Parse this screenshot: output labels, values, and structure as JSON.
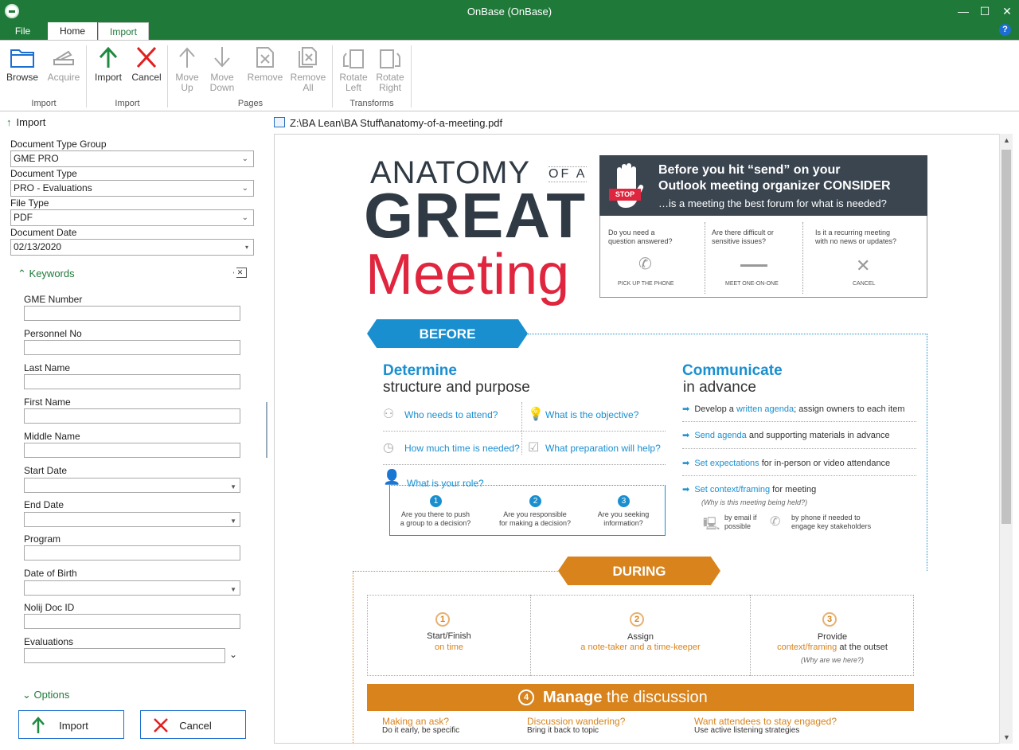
{
  "window": {
    "title": "OnBase (OnBase)",
    "minimize": "—",
    "maximize": "☐",
    "close": "✕",
    "help": "?"
  },
  "tabs": [
    {
      "label": "File"
    },
    {
      "label": "Home"
    },
    {
      "label": "Import"
    }
  ],
  "ribbon": {
    "browse": "Browse",
    "acquire": "Acquire",
    "import": "Import",
    "cancel": "Cancel",
    "move_up": [
      "Move",
      "Up"
    ],
    "move_down": [
      "Move",
      "Down"
    ],
    "remove": "Remove",
    "remove_all": [
      "Remove",
      "All"
    ],
    "rotate_left": [
      "Rotate",
      "Left"
    ],
    "rotate_right": [
      "Rotate",
      "Right"
    ],
    "groups": [
      "Import",
      "Import",
      "Pages",
      "Transforms"
    ]
  },
  "import_pane": {
    "header": "Import",
    "doc_type_group_label": "Document Type Group",
    "doc_type_group_value": "GME PRO",
    "doc_type_label": "Document Type",
    "doc_type_value": "PRO - Evaluations",
    "file_type_label": "File Type",
    "file_type_value": "PDF",
    "doc_date_label": "Document Date",
    "doc_date_value": "02/13/2020",
    "keywords_header": "Keywords",
    "keywords": [
      {
        "label": "GME Number"
      },
      {
        "label": "Personnel No"
      },
      {
        "label": "Last Name"
      },
      {
        "label": "First Name"
      },
      {
        "label": "Middle Name"
      },
      {
        "label": "Start Date"
      },
      {
        "label": "End Date"
      },
      {
        "label": "Program"
      },
      {
        "label": "Date of Birth"
      },
      {
        "label": "Nolij Doc ID"
      },
      {
        "label": "Evaluations"
      }
    ],
    "options_header": "Options",
    "import_button": "Import",
    "cancel_button": "Cancel"
  },
  "viewer": {
    "path": "Z:\\BA  Lean\\BA Stuff\\anatomy-of-a-meeting.pdf",
    "doc": {
      "anatomy": "ANATOMY",
      "of_a": "OF A",
      "great": "GREAT",
      "meeting": "Meeting",
      "stop": "STOP",
      "consider_line1": "Before you hit “send” on your",
      "consider_line2": "Outlook meeting organizer CONSIDER",
      "consider_line3": "…is a meeting the best forum for what is needed?",
      "q1": [
        "Do you need a",
        "question answered?"
      ],
      "q1_action": "PICK UP THE PHONE",
      "q2": [
        "Are there difficult or",
        "sensitive issues?"
      ],
      "q2_action": "MEET ONE-ON-ONE",
      "q3": [
        "Is it a recurring meeting",
        "with no news or updates?"
      ],
      "q3_action": "CANCEL",
      "before": "BEFORE",
      "determine": "Determine",
      "determine_sub": "structure and purpose",
      "who": "Who needs to attend?",
      "objective": "What is the objective?",
      "time": "How much time is needed?",
      "prep": "What preparation will help?",
      "role": "What is your role?",
      "roles": [
        {
          "n": "1",
          "text": [
            "Are you there to push",
            "a group to a decision?"
          ]
        },
        {
          "n": "2",
          "text": [
            "Are you responsible",
            "for making a decision?"
          ]
        },
        {
          "n": "3",
          "text": [
            "Are you seeking",
            "information?"
          ]
        }
      ],
      "communicate": "Communicate",
      "communicate_sub": "in advance",
      "c1a": "Develop a ",
      "c1b": "written agenda",
      "c1c": "; assign owners to each item",
      "c2b": "Send agenda",
      "c2c": " and supporting materials in advance",
      "c3b": "Set expectations",
      "c3c": " for in-person or video attendance",
      "c4b": "Set context/framing",
      "c4c": " for meeting",
      "c4note": "(Why is this meeting being held?)",
      "email": [
        "by email if",
        "possible"
      ],
      "phone": [
        "by phone if needed to",
        "engage key stakeholders"
      ],
      "during": "DURING",
      "d1": {
        "n": "1",
        "a": "Start/Finish",
        "b": "on time"
      },
      "d2": {
        "n": "2",
        "a": "Assign",
        "b": "a note-taker and a time-keeper"
      },
      "d3": {
        "n": "3",
        "a": "Provide",
        "b": "context/framing",
        "c": " at the outset",
        "note": "(Why are we here?)"
      },
      "manage_n": "4",
      "manage": "Manage",
      "manage_rest": " the discussion",
      "m1": "Making an ask?",
      "m1s": "Do it early, be specific",
      "m2": "Discussion wandering?",
      "m2s": "Bring it back to topic",
      "m3": "Want attendees to stay engaged?",
      "m3s": "Use active listening strategies"
    }
  },
  "colors": {
    "brand_green": "#1f7a3a",
    "accent_blue": "#1a8fd0",
    "accent_orange": "#d8831c",
    "meeting_red": "#e0253e",
    "dark": "#2f3a44"
  }
}
